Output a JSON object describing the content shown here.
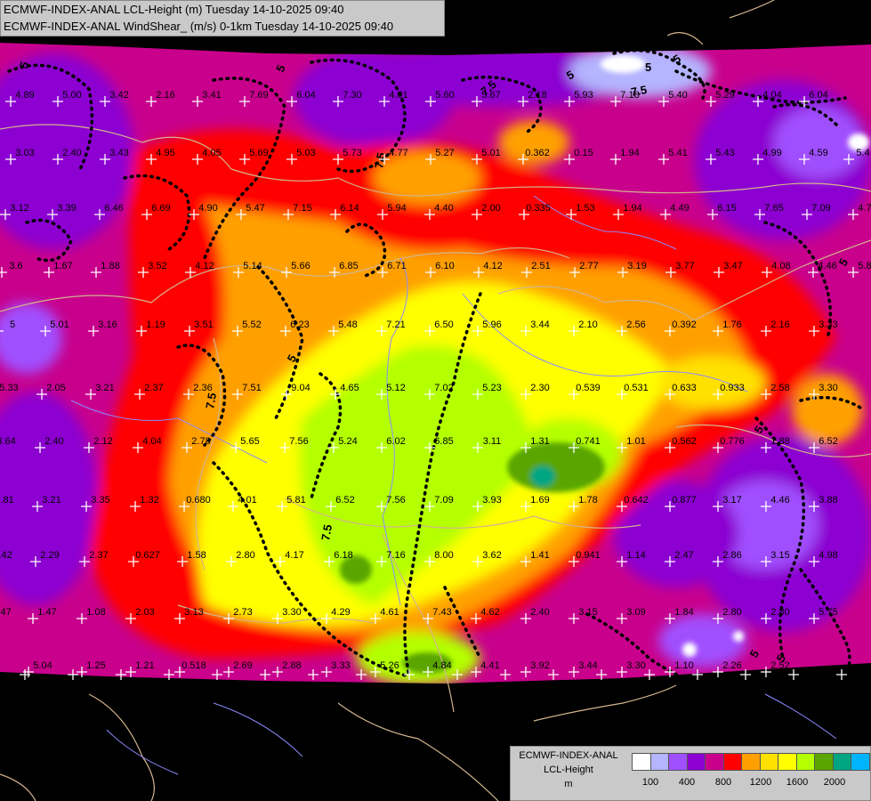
{
  "header": {
    "line1": "ECMWF-INDEX-ANAL LCL-Height (m) Tuesday 14-10-2025 09:40",
    "line2": "ECMWF-INDEX-ANAL WindShear_ (m/s) 0-1km Tuesday 14-10-2025 09:40"
  },
  "legend": {
    "title1": "ECMWF-INDEX-ANAL",
    "title2": "LCL-Height",
    "unit": "m",
    "colors": [
      "#ffffff",
      "#b4b4ff",
      "#a050ff",
      "#8c00d2",
      "#c8008c",
      "#ff0000",
      "#ffa000",
      "#ffe100",
      "#ffff00",
      "#b4ff00",
      "#5aa500",
      "#00a582",
      "#00b4ff"
    ],
    "ticks": [
      "100",
      "400",
      "800",
      "1200",
      "1600",
      "2000"
    ]
  },
  "colors": {
    "background": "#000000",
    "magenta": "#c8008c",
    "violet": "#8c00d2",
    "purple": "#a050ff",
    "lavender": "#b4b4ff",
    "red": "#ff0000",
    "orange": "#ffa000",
    "yellow": "#ffff00",
    "lightyellow": "#ffe100",
    "lime": "#b4ff00",
    "green": "#5aa500",
    "teal": "#00a582",
    "border": "#d2b48c",
    "river": "#8c8cff",
    "shear": "#000000"
  },
  "grid_values": [
    {
      "v": "4.89"
    },
    {
      "v": "5.00"
    },
    {
      "v": "3.42"
    },
    {
      "v": "2.16"
    },
    {
      "v": "3.41"
    },
    {
      "v": "7.69"
    },
    {
      "v": "6.04"
    },
    {
      "v": "7.30"
    },
    {
      "v": "4.01"
    },
    {
      "v": "5.60"
    },
    {
      "v": "5.67"
    },
    {
      "v": "2.18"
    },
    {
      "v": "5.93"
    },
    {
      "v": "7.18"
    },
    {
      "v": "5.40"
    },
    {
      "v": "5.29"
    },
    {
      "v": "4.04"
    },
    {
      "v": "6.04"
    },
    {
      "v": "3.03"
    },
    {
      "v": "2.40"
    },
    {
      "v": "3.43"
    },
    {
      "v": "4.95"
    },
    {
      "v": "4.05"
    },
    {
      "v": "5.69"
    },
    {
      "v": "5.03"
    },
    {
      "v": "5.73"
    },
    {
      "v": "4.77"
    },
    {
      "v": "5.27"
    },
    {
      "v": "5.01"
    },
    {
      "v": "0.362"
    },
    {
      "v": "0.15"
    },
    {
      "v": "1.94"
    },
    {
      "v": "5.41"
    },
    {
      "v": "5.43"
    },
    {
      "v": "4.99"
    },
    {
      "v": "4.59"
    },
    {
      "v": "5.4"
    },
    {
      "v": "3.12"
    },
    {
      "v": "3.39"
    },
    {
      "v": "6.46"
    },
    {
      "v": "6.69"
    },
    {
      "v": "4.90"
    },
    {
      "v": "5.47"
    },
    {
      "v": "7.15"
    },
    {
      "v": "6.14"
    },
    {
      "v": "5.94"
    },
    {
      "v": "4.40"
    },
    {
      "v": "2.00"
    },
    {
      "v": "0.335"
    },
    {
      "v": "1.53"
    },
    {
      "v": "1.94"
    },
    {
      "v": "4.49"
    },
    {
      "v": "6.15"
    },
    {
      "v": "7.65"
    },
    {
      "v": "7.09"
    },
    {
      "v": "4.75"
    },
    {
      "v": "3.6"
    },
    {
      "v": "1.67"
    },
    {
      "v": "1.88"
    },
    {
      "v": "3.52"
    },
    {
      "v": "4.12"
    },
    {
      "v": "5.14"
    },
    {
      "v": "5.66"
    },
    {
      "v": "6.85"
    },
    {
      "v": "6.71"
    },
    {
      "v": "6.10"
    },
    {
      "v": "4.12"
    },
    {
      "v": "2.51"
    },
    {
      "v": "2.77"
    },
    {
      "v": "3.19"
    },
    {
      "v": "3.77"
    },
    {
      "v": "3.47"
    },
    {
      "v": "4.08"
    },
    {
      "v": "4.46"
    },
    {
      "v": "5.87"
    },
    {
      "v": "5"
    },
    {
      "v": "5.01"
    },
    {
      "v": "3.16"
    },
    {
      "v": "1.19"
    },
    {
      "v": "3.51"
    },
    {
      "v": "5.52"
    },
    {
      "v": "6.23"
    },
    {
      "v": "5.48"
    },
    {
      "v": "7.21"
    },
    {
      "v": "6.50"
    },
    {
      "v": "5.96"
    },
    {
      "v": "3.44"
    },
    {
      "v": "2.10"
    },
    {
      "v": "2.56"
    },
    {
      "v": "0.392"
    },
    {
      "v": "1.76"
    },
    {
      "v": "2.16"
    },
    {
      "v": "3.33"
    },
    {
      "v": "5.33"
    },
    {
      "v": "2.05"
    },
    {
      "v": "3.21"
    },
    {
      "v": "2.37"
    },
    {
      "v": "2.36"
    },
    {
      "v": "7.51"
    },
    {
      "v": "9.04"
    },
    {
      "v": "4.65"
    },
    {
      "v": "5.12"
    },
    {
      "v": "7.02"
    },
    {
      "v": "5.23"
    },
    {
      "v": "2.30"
    },
    {
      "v": "0.539"
    },
    {
      "v": "0.531"
    },
    {
      "v": "0.633"
    },
    {
      "v": "0.933"
    },
    {
      "v": "2.58"
    },
    {
      "v": "3.30"
    },
    {
      "v": "3.64"
    },
    {
      "v": "2.40"
    },
    {
      "v": "2.12"
    },
    {
      "v": "4.04"
    },
    {
      "v": "2.78"
    },
    {
      "v": "5.65"
    },
    {
      "v": "7.56"
    },
    {
      "v": "5.24"
    },
    {
      "v": "6.02"
    },
    {
      "v": "6.85"
    },
    {
      "v": "3.11"
    },
    {
      "v": "1.31"
    },
    {
      "v": "0.741"
    },
    {
      "v": "1.01"
    },
    {
      "v": "0.562"
    },
    {
      "v": "0.776"
    },
    {
      "v": "1.88"
    },
    {
      "v": "6.52"
    },
    {
      "v": "4.81"
    },
    {
      "v": "3.21"
    },
    {
      "v": "3.35"
    },
    {
      "v": "1.32"
    },
    {
      "v": "0.680"
    },
    {
      "v": "4.01"
    },
    {
      "v": "5.81"
    },
    {
      "v": "6.52"
    },
    {
      "v": "7.56"
    },
    {
      "v": "7.09"
    },
    {
      "v": "3.93"
    },
    {
      "v": "1.69"
    },
    {
      "v": "1.78"
    },
    {
      "v": "0.642"
    },
    {
      "v": "0.877"
    },
    {
      "v": "3.17"
    },
    {
      "v": "4.46"
    },
    {
      "v": "3.88"
    },
    {
      "v": "4.42"
    },
    {
      "v": "2.29"
    },
    {
      "v": "2.37"
    },
    {
      "v": "0.627"
    },
    {
      "v": "1.58"
    },
    {
      "v": "2.80"
    },
    {
      "v": "4.17"
    },
    {
      "v": "6.18"
    },
    {
      "v": "7.16"
    },
    {
      "v": "8.00"
    },
    {
      "v": "3.62"
    },
    {
      "v": "1.41"
    },
    {
      "v": "0.941"
    },
    {
      "v": "1.14"
    },
    {
      "v": "2.47"
    },
    {
      "v": "2.86"
    },
    {
      "v": "3.15"
    },
    {
      "v": "4.98"
    },
    {
      "v": "2.47"
    },
    {
      "v": "1.47"
    },
    {
      "v": "1.08"
    },
    {
      "v": "2.03"
    },
    {
      "v": "3.13"
    },
    {
      "v": "2.73"
    },
    {
      "v": "3.30"
    },
    {
      "v": "4.29"
    },
    {
      "v": "4.61"
    },
    {
      "v": "7.43"
    },
    {
      "v": "4.62"
    },
    {
      "v": "2.40"
    },
    {
      "v": "3.15"
    },
    {
      "v": "3.09"
    },
    {
      "v": "1.84"
    },
    {
      "v": "2.80"
    },
    {
      "v": "2.80"
    },
    {
      "v": "5.75"
    },
    {
      "v": "5.04"
    },
    {
      "v": "1.25"
    },
    {
      "v": "1.21"
    },
    {
      "v": "0.518"
    },
    {
      "v": "2.69"
    },
    {
      "v": "2.88"
    },
    {
      "v": "3.33"
    },
    {
      "v": "5.26"
    },
    {
      "v": "4.84"
    },
    {
      "v": "4.41"
    },
    {
      "v": "3.92"
    },
    {
      "v": "3.44"
    },
    {
      "v": "3.30"
    },
    {
      "v": "1.10"
    },
    {
      "v": "2.26"
    },
    {
      "v": "2.52"
    },
    {
      "v": "3.25"
    }
  ],
  "contour_labels": [
    "5",
    "5",
    "5",
    "5",
    "5",
    "5",
    "7.5",
    "7.5",
    "7.5",
    "7.5",
    "7.5",
    "5",
    "5",
    "5",
    "5"
  ]
}
